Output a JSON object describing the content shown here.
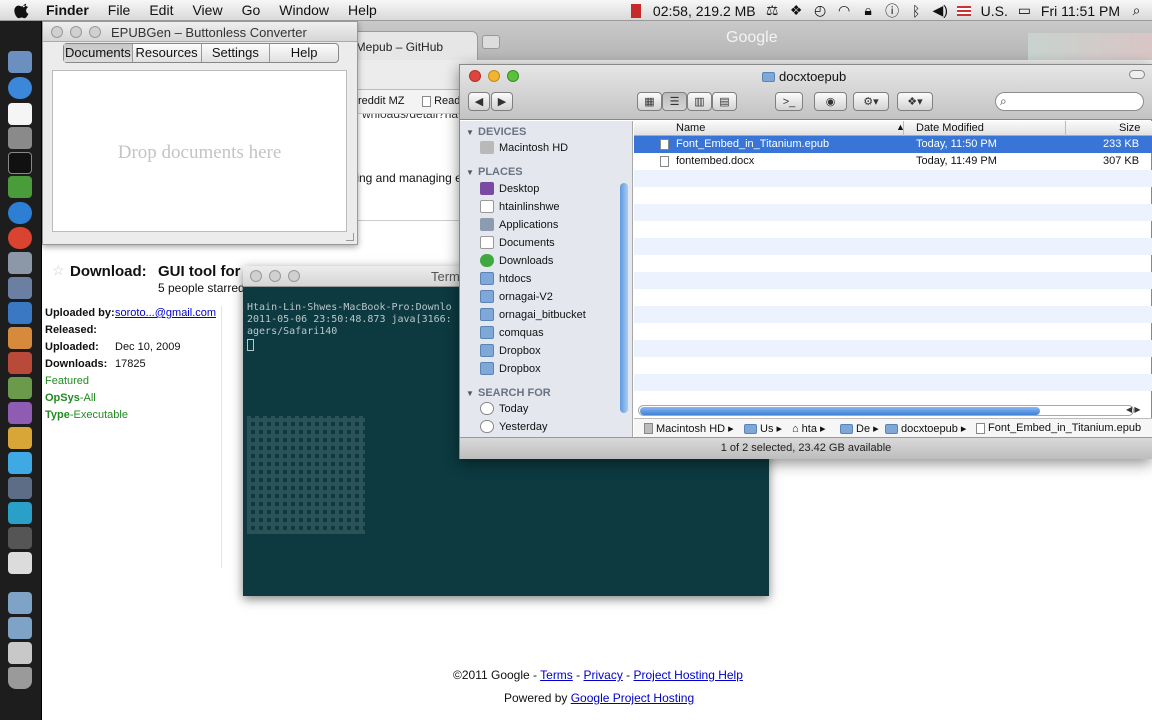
{
  "menubar": {
    "apple_icon": "apple-icon",
    "items": [
      "Finder",
      "File",
      "Edit",
      "View",
      "Go",
      "Window",
      "Help"
    ],
    "cpu_text": "02:58, 219.2 MB",
    "input_locale": "U.S.",
    "clock": "Fri 11:51 PM"
  },
  "browser": {
    "tabs": [
      "od/MMepub – GitHub"
    ],
    "watermark": "Google",
    "url_fragment": "wnloads/detail?nam",
    "bookmarks": [
      "reddit MZ",
      "Read"
    ],
    "page_snippet": "ting and managing e"
  },
  "download_page": {
    "title_prefix": "Download:",
    "title": "GUI tool for",
    "starred": "5 people starred",
    "uploaded_by_label": "Uploaded by:",
    "uploaded_by_value": "soroto...@gmail.com",
    "released_label": "Released:",
    "uploaded_label": "Uploaded:",
    "uploaded_value": "Dec 10, 2009",
    "downloads_label": "Downloads:",
    "downloads_value": "17825",
    "label_featured": "Featured",
    "label_opsys_key": "OpSys",
    "label_opsys_value": "-All",
    "label_type_key": "Type",
    "label_type_value": "-Executable"
  },
  "footer": {
    "copyright": "©2011 Google",
    "sep": " - ",
    "terms": "Terms",
    "privacy": "Privacy",
    "help": "Project Hosting Help",
    "powered_by": "Powered by",
    "powered_link": "Google Project Hosting"
  },
  "epubgen": {
    "title": "EPUBGen – Buttonless Converter",
    "tabs": [
      "Documents",
      "Resources",
      "Settings",
      "Help"
    ],
    "active_tab": "Documents",
    "drop_text": "Drop documents here"
  },
  "terminal": {
    "title": "Term",
    "lines": [
      "Htain-Lin-Shwes-MacBook-Pro:Downlo",
      "2011-05-06 23:50:48.873 java[3166:",
      "agers/Safari140"
    ]
  },
  "finder": {
    "title": "docxtoepub",
    "sidebar": {
      "devices_header": "DEVICES",
      "devices": [
        "Macintosh HD"
      ],
      "places_header": "PLACES",
      "places": [
        "Desktop",
        "htainlinshwe",
        "Applications",
        "Documents",
        "Downloads",
        "htdocs",
        "ornagai-V2",
        "ornagai_bitbucket",
        "comquas",
        "Dropbox",
        "Dropbox"
      ],
      "search_header": "SEARCH FOR",
      "search": [
        "Today",
        "Yesterday"
      ]
    },
    "columns": {
      "name": "Name",
      "date": "Date Modified",
      "size": "Size"
    },
    "files": [
      {
        "name": "Font_Embed_in_Titanium.epub",
        "date": "Today, 11:50 PM",
        "size": "233 KB",
        "selected": true
      },
      {
        "name": "fontembed.docx",
        "date": "Today, 11:49 PM",
        "size": "307 KB",
        "selected": false
      }
    ],
    "path": [
      "Macintosh HD",
      "Us",
      "hta",
      "De",
      "docxtoepub",
      "Font_Embed_in_Titanium.epub"
    ],
    "status": "1 of 2 selected, 23.42 GB available",
    "toolbar_icons": [
      "back-icon",
      "forward-icon",
      "icon-view-icon",
      "list-view-icon",
      "column-view-icon",
      "coverflow-view-icon",
      "terminal-icon",
      "quicklook-icon",
      "action-gear-icon",
      "dropbox-icon",
      "search-icon"
    ]
  },
  "colors": {
    "selection": "#3875d7",
    "terminal_bg": "#0c3a40",
    "dock_bg": "#1d1d1d",
    "link": "#0000cc",
    "featured_green": "#228b22"
  }
}
